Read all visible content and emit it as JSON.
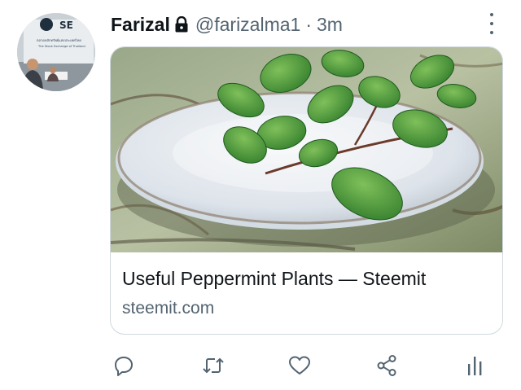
{
  "author": {
    "name": "Farizal",
    "handle": "@farizalma1",
    "separator": "·",
    "time": "3m",
    "avatar_logo": "SE",
    "avatar_line1": "ตลาดหลักทรัพย์แห่งประเทศไทย",
    "avatar_line2": "The Stock Exchange of Thailand"
  },
  "card": {
    "title": "Useful Peppermint Plants — Steemit",
    "domain": "steemit.com"
  },
  "icons": {
    "lock": "lock-icon",
    "more": "more-vertical-icon",
    "reply": "comment-bubble-icon",
    "retweet": "retweet-icon",
    "like": "heart-icon",
    "share": "share-icon",
    "analytics": "analytics-bars-icon"
  },
  "colors": {
    "text": "#0f1419",
    "secondary": "#536471",
    "border": "#cfd9de"
  }
}
